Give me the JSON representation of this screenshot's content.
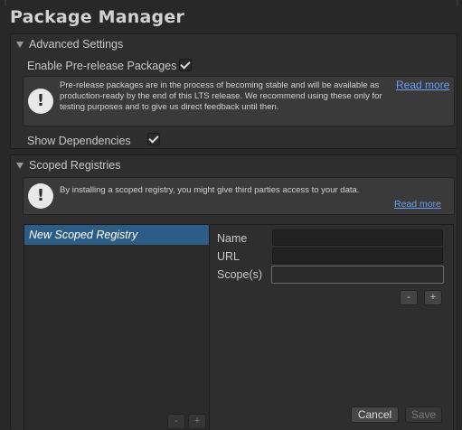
{
  "window": {
    "title": "Package Manager"
  },
  "advanced": {
    "header": "Advanced Settings",
    "prerelease_label": "Enable Pre-release Packages",
    "prerelease_checked": true,
    "help_text": "Pre-release packages are in the process of becoming stable and will be available as production-ready by the end of this LTS release. We recommend using these only for testing purposes and to give us direct feedback until then.",
    "read_more": "Read more",
    "dependencies_label": "Show Dependencies",
    "dependencies_checked": true
  },
  "scoped": {
    "header": "Scoped Registries",
    "help_text": "By installing a scoped registry, you might give third parties access to your data.",
    "read_more": "Read more",
    "registries": [
      "New Scoped Registry"
    ],
    "fields": {
      "name": "Name",
      "url": "URL",
      "scopes": "Scope(s)"
    },
    "list_remove": "-",
    "list_add": "+",
    "scope_remove": "-",
    "scope_add": "+",
    "cancel": "Cancel",
    "save": "Save"
  },
  "colors": {
    "accent": "#2c5d87",
    "link": "#6b9ff0",
    "background": "#282828"
  },
  "icons": {
    "help": "exclamation-circle-icon",
    "foldout": "triangle-down-icon",
    "checkbox": "checkmark-icon"
  }
}
